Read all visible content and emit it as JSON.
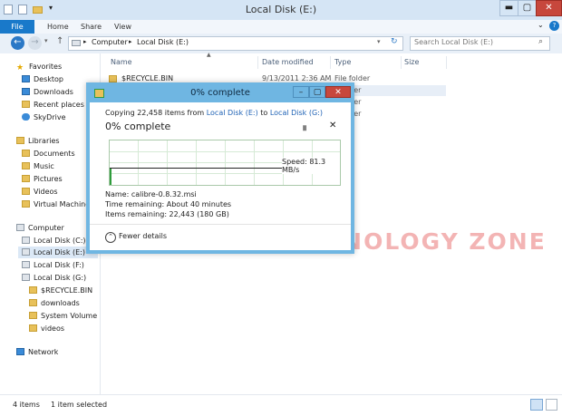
{
  "window": {
    "title": "Local Disk (E:)"
  },
  "ribbon": {
    "tabs": [
      "File",
      "Home",
      "Share",
      "View"
    ]
  },
  "address": {
    "path": [
      "Computer",
      "Local Disk (E:)"
    ],
    "search_placeholder": "Search Local Disk (E:)"
  },
  "nav": {
    "favorites": {
      "label": "Favorites",
      "items": [
        "Desktop",
        "Downloads",
        "Recent places",
        "SkyDrive"
      ]
    },
    "libraries": {
      "label": "Libraries",
      "items": [
        "Documents",
        "Music",
        "Pictures",
        "Videos",
        "Virtual Machines"
      ]
    },
    "computer": {
      "label": "Computer",
      "items": [
        "Local Disk (C:)",
        "Local Disk (E:)",
        "Local Disk (F:)",
        "Local Disk (G:)"
      ]
    },
    "g_children": [
      "$RECYCLE.BIN",
      "downloads",
      "System Volume In",
      "videos"
    ],
    "network": {
      "label": "Network"
    }
  },
  "columns": {
    "name": "Name",
    "date": "Date modified",
    "type": "Type",
    "size": "Size"
  },
  "files": [
    {
      "name": "$RECYCLE.BIN",
      "date": "9/13/2011 2:36 AM",
      "type": "File folder"
    },
    {
      "name": "",
      "date": "",
      "type": "older"
    },
    {
      "name": "",
      "date": "",
      "type": "older"
    },
    {
      "name": "",
      "date": "",
      "type": "older"
    }
  ],
  "status": {
    "count": "4 items",
    "selected": "1 item selected"
  },
  "watermark": "THE TECHNOLOGY ZONE",
  "dialog": {
    "title": "0% complete",
    "copy_prefix": "Copying 22,458 items from",
    "source": "Local Disk (E:)",
    "to_word": "to",
    "dest": "Local Disk (G:)",
    "heading": "0% complete",
    "progress_percent": 0,
    "speed": "Speed: 81.3 MB/s",
    "name": "Name:  calibre-0.8.32.msi",
    "time_remaining": "Time remaining:  About 40 minutes",
    "items_remaining": "Items remaining:  22,443 (180 GB)",
    "fewer_details": "Fewer details"
  },
  "colors": {
    "accent": "#1979ca",
    "dialog_border": "#6fb6e2",
    "close": "#c7473c"
  }
}
